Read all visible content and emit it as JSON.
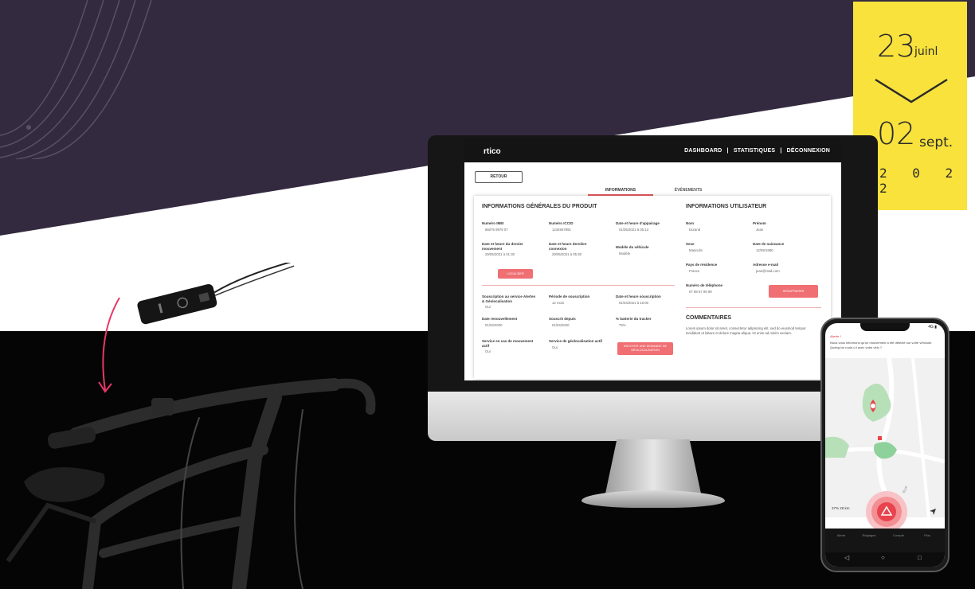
{
  "date_range": {
    "start_day": "23",
    "start_month": "juinl",
    "end_day": "02",
    "end_month": "sept.",
    "year": "2 0 2 2"
  },
  "dashboard": {
    "logo": "rtico",
    "nav": {
      "dashboard": "DASHBOARD",
      "separator": "|",
      "statistiques": "STATISTIQUES",
      "deconnexion": "DÉCONNEXION"
    },
    "back_label": "RETOUR",
    "tabs": [
      "INFORMATIONS",
      "ÉVÉNEMENTS"
    ],
    "product_title": "INFORMATIONS GÉNÉRALES DU PRODUIT",
    "product_fields": [
      {
        "label": "Numéro IMEI",
        "value": "86076 9978 07"
      },
      {
        "label": "Numéro ICCID",
        "value": "1234567891"
      },
      {
        "label": "Date et heure d'appairage",
        "value": "01/05/2021 à 05:13"
      },
      {
        "label": "Date et heure du dernier mouvement",
        "value": "29/05/2021 à 01:30"
      },
      {
        "label": "Date et heure dernière connexion",
        "value": "29/05/2021 à 05:30"
      },
      {
        "label": "Modèle du véhicule",
        "value": "Modèle"
      }
    ],
    "product_button": "LOCALISER",
    "service_fields": [
      {
        "label": "Souscription au service Alertes & Géolocalisation",
        "value": "Oui"
      },
      {
        "label": "Période de souscription",
        "value": "12 mois"
      },
      {
        "label": "Date et heure souscription",
        "value": "01/04/2021 à 16:00"
      },
      {
        "label": "Date renouvellement",
        "value": "01/04/2020"
      },
      {
        "label": "Souscrit depuis",
        "value": "01/04/2020"
      },
      {
        "label": "% batterie du tracker",
        "value": "75%"
      },
      {
        "label": "Service en cas de mouvement actif",
        "value": "Oui"
      },
      {
        "label": "Service de géolocalisation actif",
        "value": "Oui"
      }
    ],
    "service_button": "ENVOYER UNE DEMANDE DE GÉOLOCALISATION",
    "user_title": "INFORMATIONS UTILISATEUR",
    "user_fields": [
      {
        "label": "Nom",
        "value": "Durand"
      },
      {
        "label": "Prénom",
        "value": "Jean"
      },
      {
        "label": "Sexe",
        "value": "Masculin"
      },
      {
        "label": "Date de naissance",
        "value": "12/09/1980"
      },
      {
        "label": "Pays de résidence",
        "value": "France"
      },
      {
        "label": "Adresse e-mail",
        "value": "jean@mail.com"
      },
      {
        "label": "Numéro de téléphone",
        "value": "07 88 67 99 99"
      }
    ],
    "user_button": "DÉSAPPAIRER",
    "comments_title": "COMMENTAIRES",
    "comments_text": "Lorem ipsum dolor sit amet, consectetur adipiscing elit, sed do eiusmod tempor incididunt ut labore et dolore magna aliqua. Ut enim ad minim veniam."
  },
  "phone": {
    "status": "4G ▮",
    "alert_title": "Alerte !",
    "message": "Nous vous informons qu'un mouvement a été détecté sur votre véhicule. Quelqu'un roule-t-il avec votre vélo ?",
    "stat_percent": "37%",
    "stat_distance": "28 km",
    "tabs": [
      "Alerte",
      "Réglages",
      "Compte",
      "Plus"
    ],
    "nav_back": "◁",
    "nav_home": "○",
    "nav_recent": "□"
  },
  "colors": {
    "purple": "#342a40",
    "yellow": "#f8e23b",
    "accent": "#ef6f73",
    "pink_arrow": "#e8386a"
  }
}
